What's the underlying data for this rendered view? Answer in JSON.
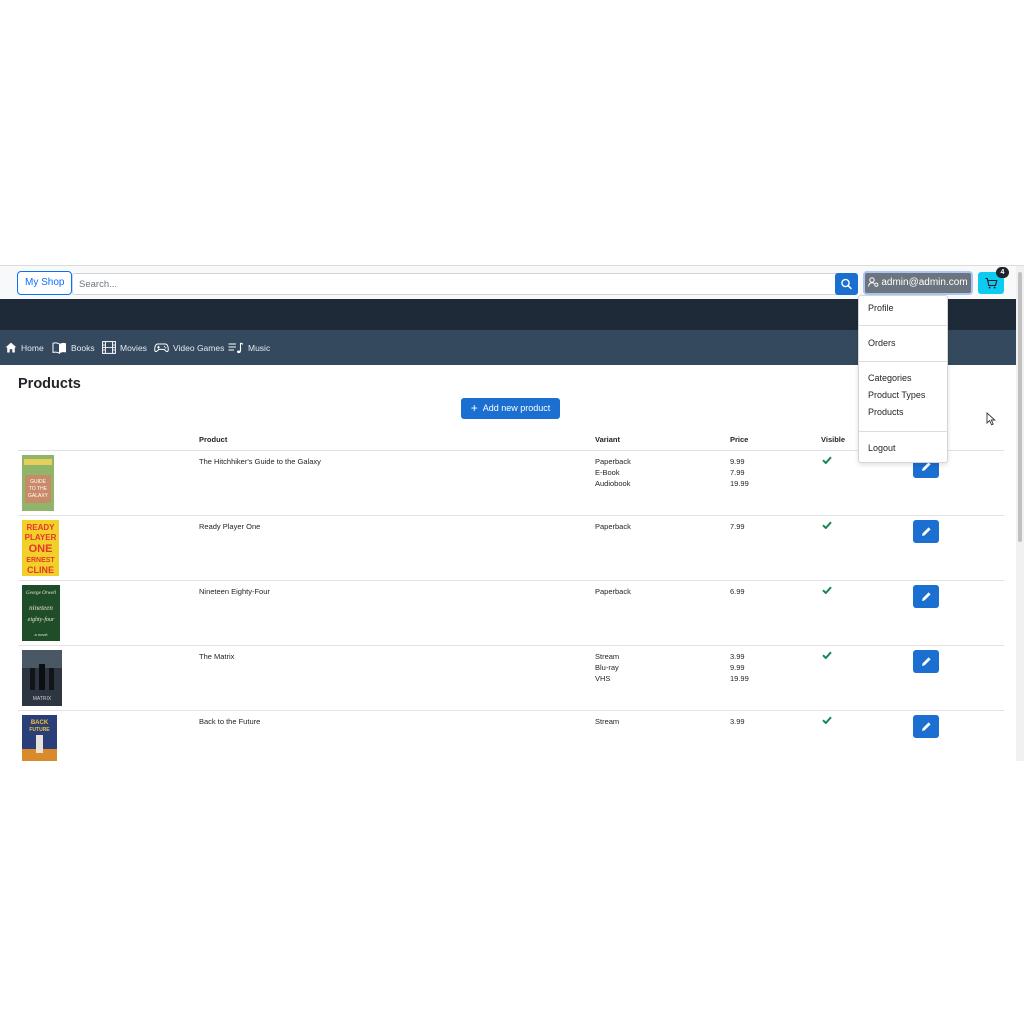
{
  "header": {
    "brand": "My Shop",
    "search_placeholder": "Search...",
    "user_label": "admin@admin.com",
    "cart_count": "4"
  },
  "nav": {
    "items": [
      {
        "label": "Home",
        "icon": "home-icon"
      },
      {
        "label": "Books",
        "icon": "book-icon"
      },
      {
        "label": "Movies",
        "icon": "film-icon"
      },
      {
        "label": "Video Games",
        "icon": "gamepad-icon"
      },
      {
        "label": "Music",
        "icon": "music-icon"
      }
    ]
  },
  "main": {
    "title": "Products",
    "add_button": "Add new product"
  },
  "table": {
    "headers": [
      "Product",
      "Variant",
      "Price",
      "Visible"
    ],
    "rows": [
      {
        "product": "The Hitchhiker's Guide to the Galaxy",
        "variants": [
          "Paperback",
          "E-Book",
          "Audiobook"
        ],
        "prices": [
          "9.99",
          "7.99",
          "19.99"
        ],
        "visible": true
      },
      {
        "product": "Ready Player One",
        "variants": [
          "Paperback"
        ],
        "prices": [
          "7.99"
        ],
        "visible": true
      },
      {
        "product": "Nineteen Eighty-Four",
        "variants": [
          "Paperback"
        ],
        "prices": [
          "6.99"
        ],
        "visible": true
      },
      {
        "product": "The Matrix",
        "variants": [
          "Stream",
          "Blu-ray",
          "VHS"
        ],
        "prices": [
          "3.99",
          "9.99",
          "19.99"
        ],
        "visible": true
      },
      {
        "product": "Back to the Future",
        "variants": [
          "Stream"
        ],
        "prices": [
          "3.99"
        ],
        "visible": true
      }
    ]
  },
  "dropdown": {
    "profile": "Profile",
    "orders": "Orders",
    "categories": "Categories",
    "product_types": "Product Types",
    "products": "Products",
    "logout": "Logout"
  },
  "covers": {
    "hitchhiker": [
      "GUIDE",
      "TO THE",
      "GALAXY"
    ],
    "ready_player": [
      "READY",
      "PLAYER",
      "ONE",
      "ERNEST",
      "CLINE"
    ],
    "nineteen": [
      "George Orwell",
      "nineteen",
      "eighty-four",
      "a novel"
    ],
    "matrix": [
      "MATRIX"
    ],
    "back_future": [
      "BACK",
      "FUTURE"
    ]
  },
  "colors": {
    "primary": "#1a6fd0",
    "navbar": "#34495e",
    "darkband": "#1e2a38",
    "cart": "#0dcaf0",
    "check": "#198754"
  }
}
